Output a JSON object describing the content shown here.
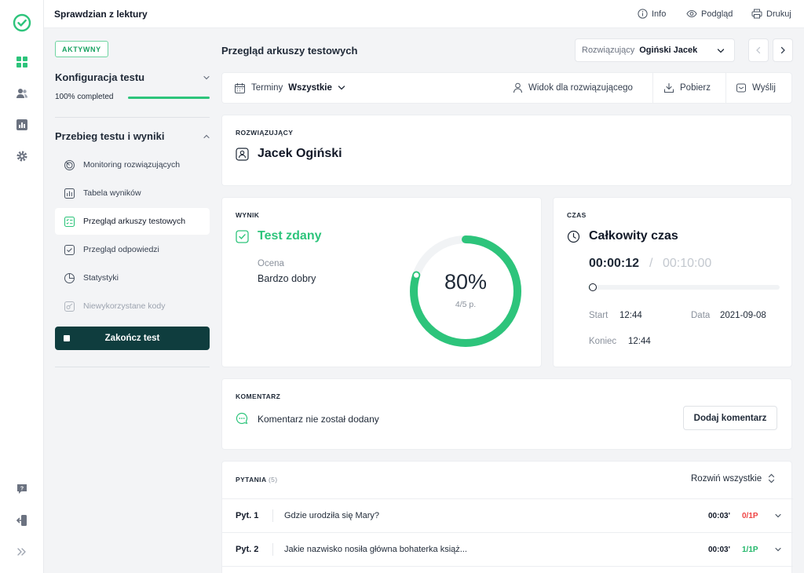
{
  "app": {
    "title": "Sprawdzian z lektury"
  },
  "topbar": {
    "info": "Info",
    "preview": "Podgląd",
    "print": "Drukuj"
  },
  "rail": {
    "icons": [
      "logo-check-icon",
      "dashboard-grid-icon",
      "users-icon",
      "chart-icon",
      "settings-icon",
      "help-chat-icon",
      "logout-icon",
      "expand-icon"
    ]
  },
  "sidebar": {
    "status_badge": "AKTYWNY",
    "config": {
      "title": "Konfiguracja testu",
      "progress_label": "100% completed"
    },
    "flow": {
      "title": "Przebieg testu i wyniki"
    },
    "items": [
      {
        "label": "Monitoring rozwiązujących",
        "icon": "monitoring-icon"
      },
      {
        "label": "Tabela wyników",
        "icon": "results-table-icon"
      },
      {
        "label": "Przegląd arkuszy testowych",
        "icon": "sheet-review-icon"
      },
      {
        "label": "Przegląd odpowiedzi",
        "icon": "answers-check-icon"
      },
      {
        "label": "Statystyki",
        "icon": "pie-chart-icon"
      },
      {
        "label": "Niewykorzystane kody",
        "icon": "unused-codes-icon"
      }
    ],
    "end_button": "Zakończ test"
  },
  "main": {
    "title": "Przegląd arkuszy testowych",
    "solver_select": {
      "label": "Rozwiązujący",
      "value": "Ogiński Jacek"
    },
    "toolbar": {
      "terms_label": "Terminy",
      "terms_value": "Wszystkie",
      "solver_view": "Widok dla rozwiązującego",
      "download": "Pobierz",
      "send": "Wyślij"
    },
    "solver_card": {
      "label": "ROZWIĄZUJĄCY",
      "name": "Jacek Ogiński"
    },
    "result_card": {
      "label": "WYNIK",
      "status": "Test zdany",
      "grade_label": "Ocena",
      "grade_value": "Bardzo dobry",
      "percent_text": "80%",
      "percent_value": 0.8,
      "points": "4/5 p."
    },
    "time_card": {
      "label": "CZAS",
      "title": "Całkowity czas",
      "elapsed": "00:00:12",
      "separator": "/",
      "limit": "00:10:00",
      "time_fraction": 0.02,
      "start_label": "Start",
      "start_value": "12:44",
      "date_label": "Data",
      "date_value": "2021-09-08",
      "end_label": "Koniec",
      "end_value": "12:44"
    },
    "comment_card": {
      "label": "KOMENTARZ",
      "text": "Komentarz nie został dodany",
      "button": "Dodaj komentarz"
    },
    "questions": {
      "label": "PYTANIA",
      "count": "(5)",
      "expand_all": "Rozwiń wszystkie",
      "rows": [
        {
          "num": "Pyt. 1",
          "text": "Gdzie urodziła się Mary?",
          "time": "00:03'",
          "points": "0/1P",
          "status_color": "#ef4444"
        },
        {
          "num": "Pyt. 2",
          "text": "Jakie nazwisko nosiła główna bohaterka książ...",
          "time": "00:03'",
          "points": "1/1P",
          "status_color": "#22b76a"
        }
      ]
    }
  },
  "colors": {
    "accent": "#2dc47b",
    "dark": "#0f3d3e",
    "fail": "#ef4444"
  }
}
